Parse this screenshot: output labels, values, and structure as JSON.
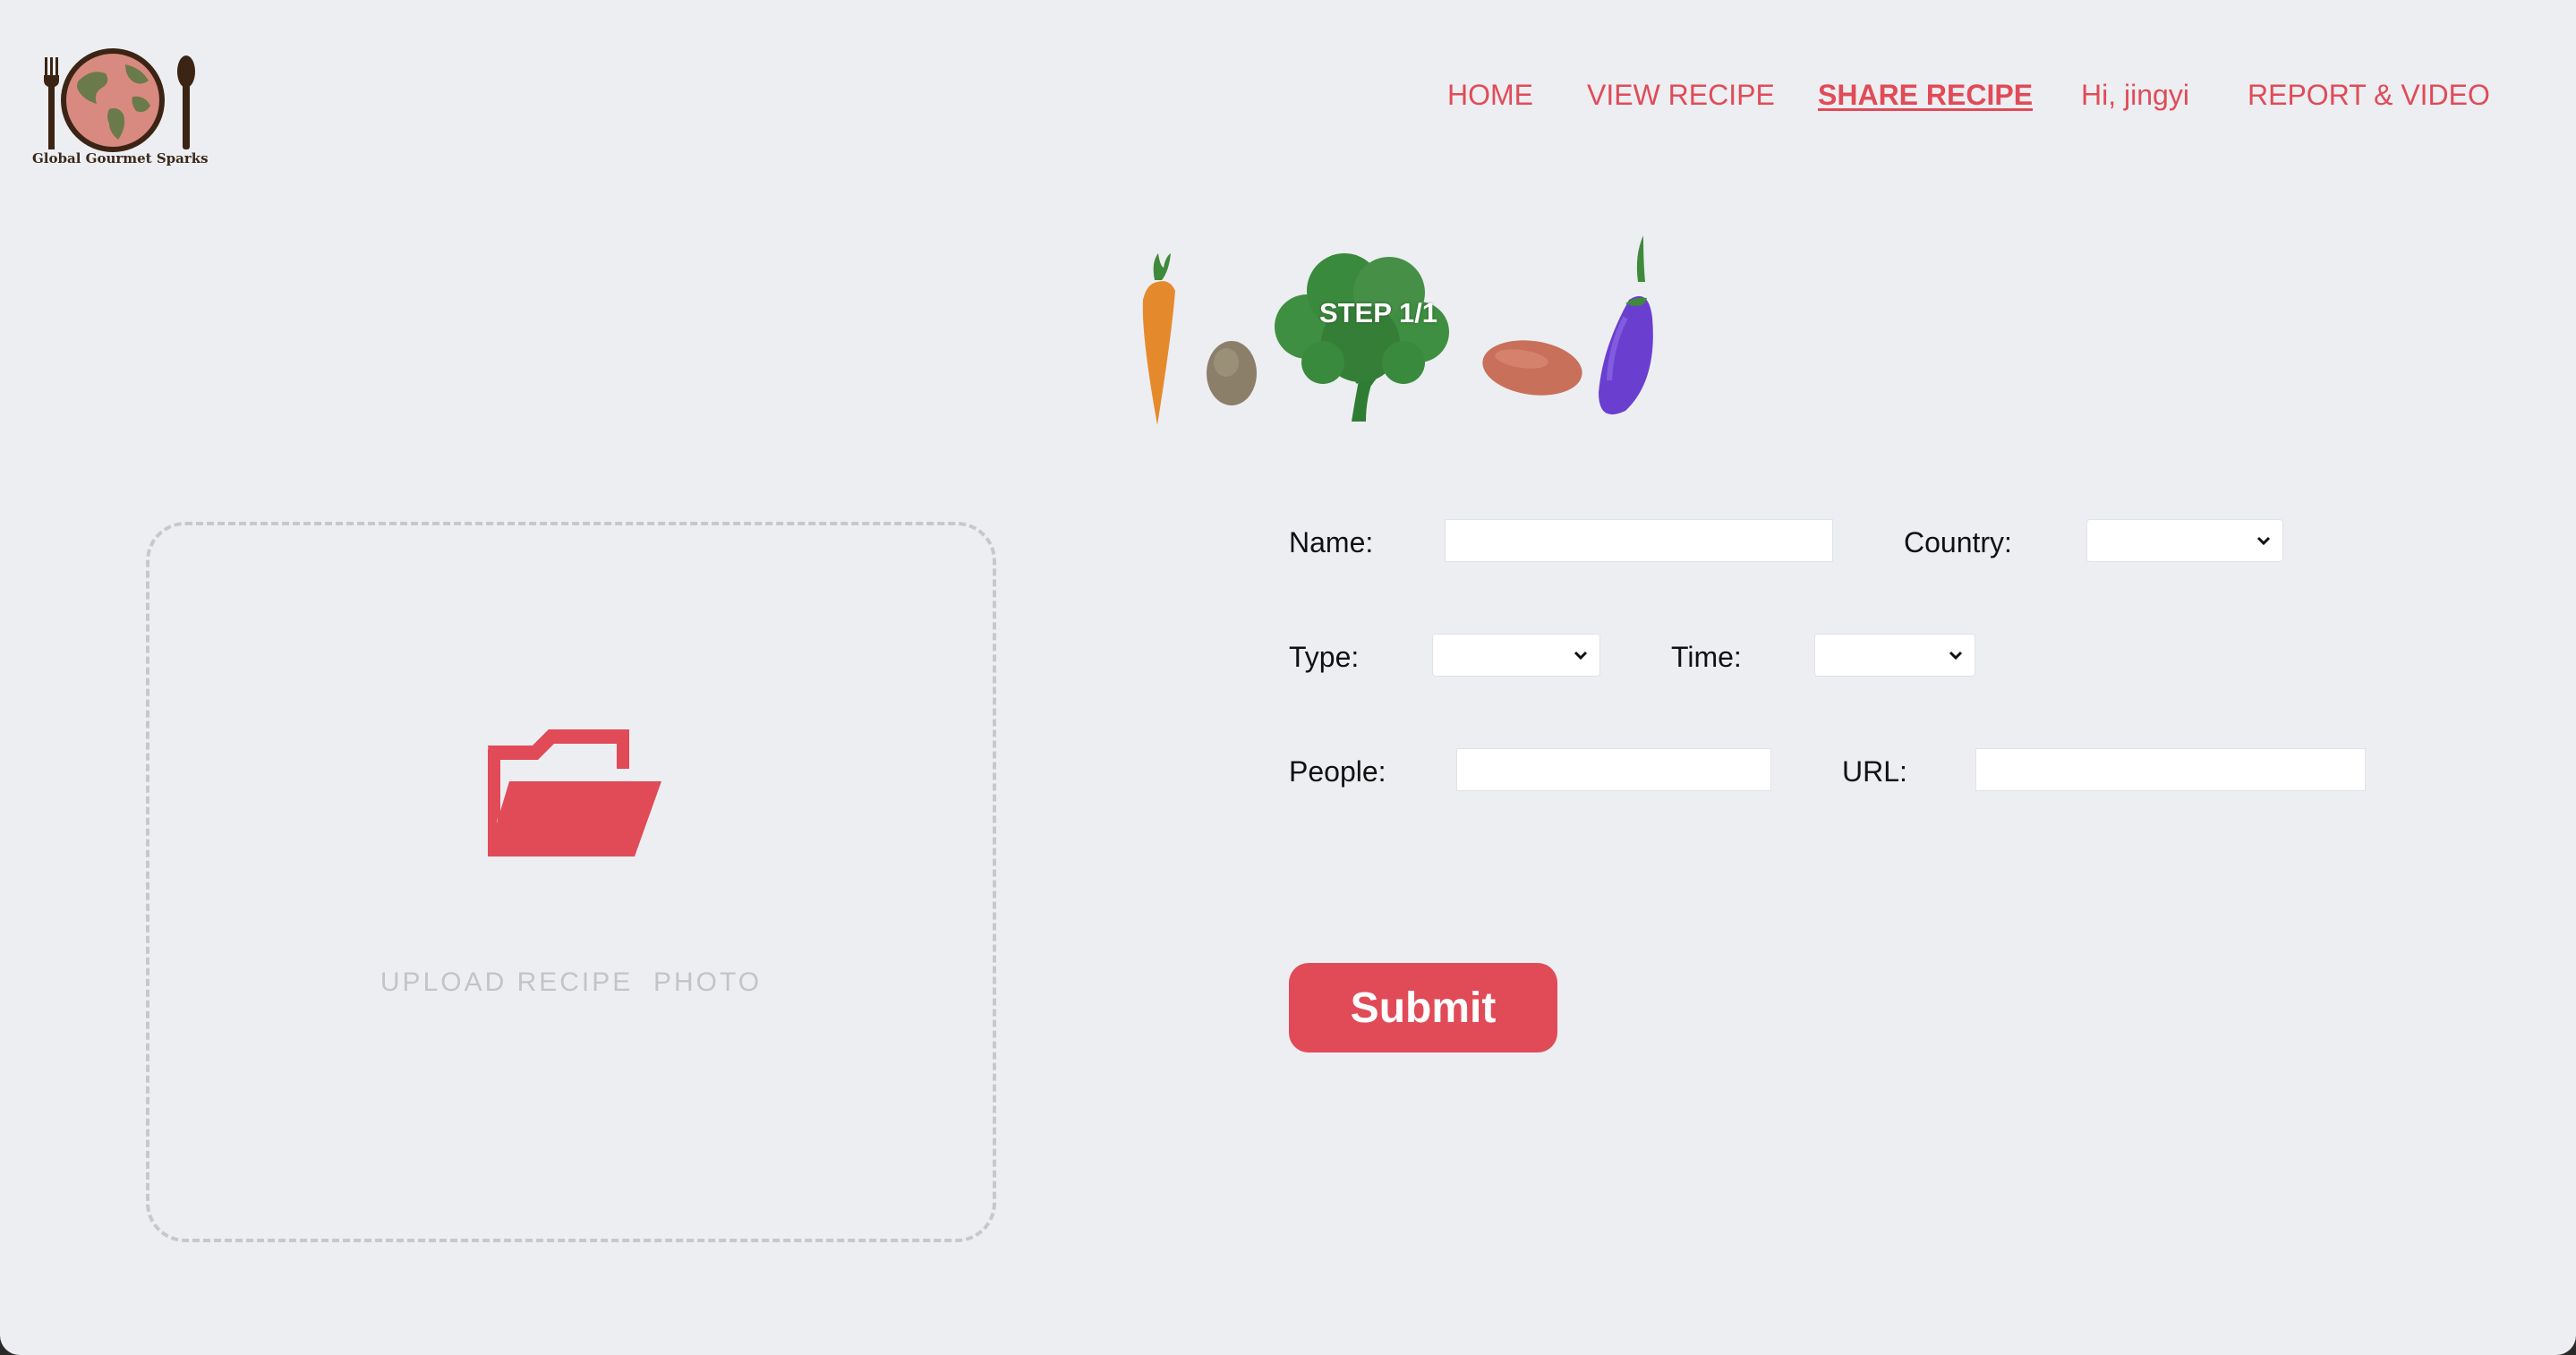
{
  "logo": {
    "text": "Global Gourmet Sparks",
    "icon": "fork-globe-spoon-logo"
  },
  "nav": {
    "items": [
      {
        "label": "HOME"
      },
      {
        "label": "VIEW RECIPE"
      },
      {
        "label": "SHARE RECIPE",
        "active": true
      },
      {
        "label": "Hi, jingyi"
      },
      {
        "label": "REPORT & VIDEO"
      }
    ]
  },
  "step": {
    "label": "STEP 1/1"
  },
  "upload": {
    "icon": "folder-open-icon",
    "label": "UPLOAD RECIPE  PHOTO"
  },
  "form": {
    "name_label": "Name:",
    "name_value": "",
    "country_label": "Country:",
    "country_value": "",
    "type_label": "Type:",
    "type_value": "",
    "time_label": "Time:",
    "time_value": "",
    "people_label": "People:",
    "people_value": "",
    "url_label": "URL:",
    "url_value": ""
  },
  "submit_label": "Submit",
  "colors": {
    "accent": "#e04b57",
    "background": "#edeef2",
    "upload_border": "#c8c8cc"
  }
}
